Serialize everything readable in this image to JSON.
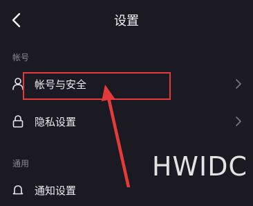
{
  "header": {
    "title": "设置"
  },
  "sections": [
    {
      "label": "帐号",
      "items": [
        {
          "label": "帐号与安全"
        },
        {
          "label": "隐私设置"
        }
      ]
    },
    {
      "label": "通用",
      "items": [
        {
          "label": "通知设置"
        }
      ]
    }
  ],
  "watermark": "HWIDC",
  "colors": {
    "background": "#1b1a22",
    "highlight": "#e53a3a",
    "text": "#ececf0",
    "muted": "#8a8994"
  }
}
